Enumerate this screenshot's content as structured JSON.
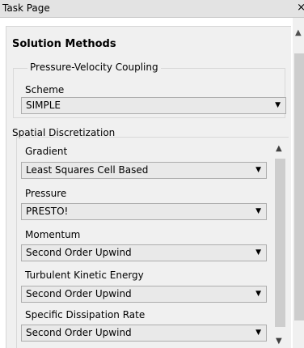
{
  "titlebar": {
    "title": "Task Page",
    "close_label": "×"
  },
  "heading": "Solution Methods",
  "pressure_velocity": {
    "legend": "Pressure-Velocity Coupling",
    "scheme_label": "Scheme",
    "scheme_value": "SIMPLE"
  },
  "spatial": {
    "legend": "Spatial Discretization",
    "gradient_label": "Gradient",
    "gradient_value": "Least Squares Cell Based",
    "pressure_label": "Pressure",
    "pressure_value": "PRESTO!",
    "momentum_label": "Momentum",
    "momentum_value": "Second Order Upwind",
    "tke_label": "Turbulent Kinetic Energy",
    "tke_value": "Second Order Upwind",
    "sdr_label": "Specific Dissipation Rate",
    "sdr_value": "Second Order Upwind"
  },
  "icons": {
    "dropdown": "chevron-down-icon",
    "scroll_up": "chevron-up-icon",
    "scroll_down": "chevron-down-icon",
    "close": "close-icon"
  }
}
